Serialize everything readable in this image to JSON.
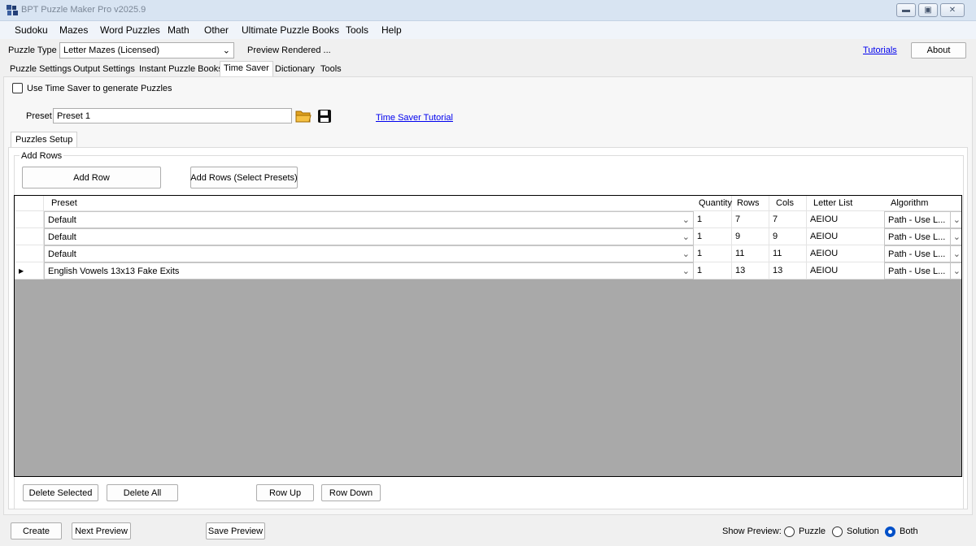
{
  "window": {
    "title": "BPT Puzzle Maker Pro v2025.9"
  },
  "menu": [
    "Sudoku",
    "Mazes",
    "Word Puzzles",
    "Math",
    "Other",
    "Ultimate Puzzle Books",
    "Tools",
    "Help"
  ],
  "toolbar": {
    "puzzle_type_label": "Puzzle Type",
    "puzzle_type_value": "Letter Mazes (Licensed)",
    "preview_status": "Preview Rendered ...",
    "tutorials_link": "Tutorials",
    "about_button": "About"
  },
  "tabs": [
    "Puzzle Settings",
    "Output Settings",
    "Instant Puzzle Books",
    "Time Saver",
    "Dictionary",
    "Tools"
  ],
  "active_tab": "Time Saver",
  "time_saver": {
    "use_checkbox_label": "Use Time Saver to generate Puzzles",
    "use_checked": false,
    "preset_label": "Preset",
    "preset_value": "Preset 1",
    "tutorial_link": "Time Saver Tutorial",
    "subtab": "Puzzles Setup",
    "add_rows_group": "Add Rows",
    "add_row_button": "Add Row",
    "add_rows_presets_button": "Add Rows (Select Presets)"
  },
  "grid": {
    "columns": [
      "Preset",
      "Quantity",
      "Rows",
      "Cols",
      "Letter List",
      "Algorithm"
    ],
    "rows": [
      {
        "preset": "Default",
        "quantity": "1",
        "rows": "7",
        "cols": "7",
        "letters": "AEIOU",
        "algorithm": "Path - Use L...",
        "current": false
      },
      {
        "preset": "Default",
        "quantity": "1",
        "rows": "9",
        "cols": "9",
        "letters": "AEIOU",
        "algorithm": "Path - Use L...",
        "current": false
      },
      {
        "preset": "Default",
        "quantity": "1",
        "rows": "11",
        "cols": "11",
        "letters": "AEIOU",
        "algorithm": "Path - Use L...",
        "current": false
      },
      {
        "preset": "English Vowels 13x13 Fake Exits",
        "quantity": "1",
        "rows": "13",
        "cols": "13",
        "letters": "AEIOU",
        "algorithm": "Path - Use L...",
        "current": true
      }
    ]
  },
  "grid_buttons": {
    "delete_selected": "Delete Selected",
    "delete_all": "Delete All",
    "row_up": "Row Up",
    "row_down": "Row Down"
  },
  "bottom": {
    "create": "Create",
    "next_preview": "Next Preview",
    "save_preview": "Save Preview",
    "show_preview_label": "Show Preview:",
    "options": [
      "Puzzle",
      "Solution",
      "Both"
    ],
    "selected_option": "Both"
  },
  "colors": {
    "link": "#0000ee",
    "grid_bg": "#a9a9a9",
    "titlebar": "#d8e4f2"
  }
}
